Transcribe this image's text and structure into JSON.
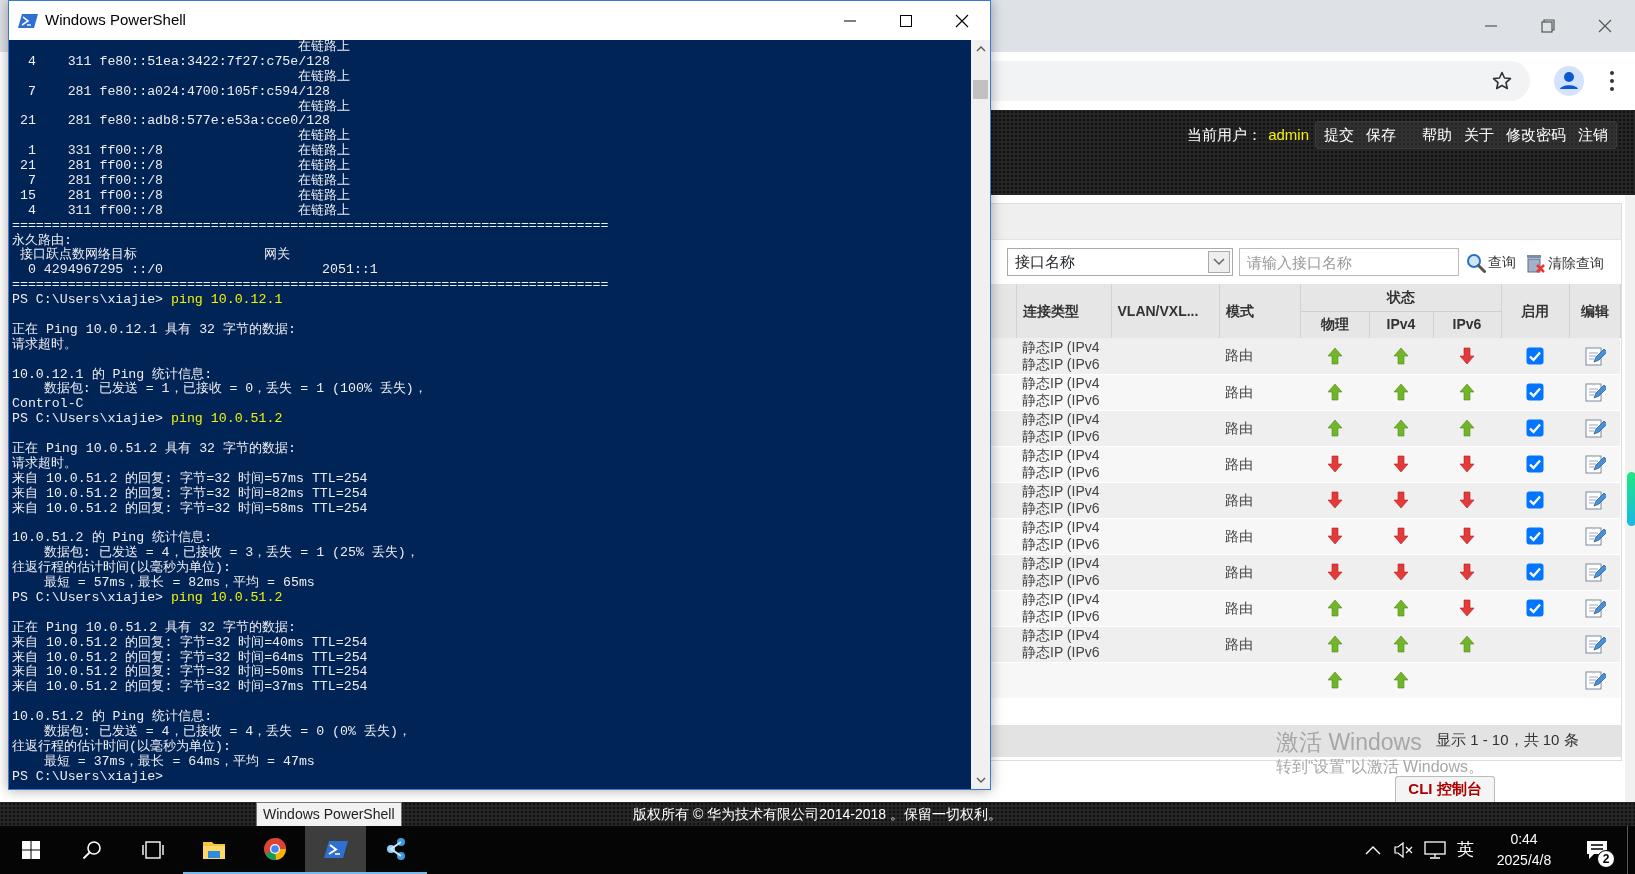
{
  "powershell": {
    "title": "Windows PowerShell",
    "lines": [
      {
        "text": "                                    在链路上"
      },
      {
        "text": "  4    311 fe80::51ea:3422:7f27:c75e/128"
      },
      {
        "text": "                                    在链路上"
      },
      {
        "text": "  7    281 fe80::a024:4700:105f:c594/128"
      },
      {
        "text": "                                    在链路上"
      },
      {
        "text": " 21    281 fe80::adb8:577e:e53a:cce0/128"
      },
      {
        "text": "                                    在链路上"
      },
      {
        "text": "  1    331 ff00::/8                 在链路上"
      },
      {
        "text": " 21    281 ff00::/8                 在链路上"
      },
      {
        "text": "  7    281 ff00::/8                 在链路上"
      },
      {
        "text": " 15    281 ff00::/8                 在链路上"
      },
      {
        "text": "  4    311 ff00::/8                 在链路上"
      },
      {
        "text": "==========================================================================="
      },
      {
        "text": "永久路由:"
      },
      {
        "text": " 接口跃点数网络目标                网关"
      },
      {
        "text": "  0 4294967295 ::/0                    2051::1"
      },
      {
        "text": "==========================================================================="
      },
      {
        "kind": "prompt",
        "prompt": "PS C:\\Users\\xiajie>",
        "command": "ping 10.0.12.1"
      },
      {
        "kind": "blank"
      },
      {
        "text": "正在 Ping 10.0.12.1 具有 32 字节的数据:"
      },
      {
        "text": "请求超时。"
      },
      {
        "kind": "blank"
      },
      {
        "text": "10.0.12.1 的 Ping 统计信息:"
      },
      {
        "text": "    数据包: 已发送 = 1，已接收 = 0，丢失 = 1 (100% 丢失)，"
      },
      {
        "text": "Control-C"
      },
      {
        "kind": "prompt",
        "prompt": "PS C:\\Users\\xiajie>",
        "command": "ping 10.0.51.2"
      },
      {
        "kind": "blank"
      },
      {
        "text": "正在 Ping 10.0.51.2 具有 32 字节的数据:"
      },
      {
        "text": "请求超时。"
      },
      {
        "text": "来自 10.0.51.2 的回复: 字节=32 时间=57ms TTL=254"
      },
      {
        "text": "来自 10.0.51.2 的回复: 字节=32 时间=82ms TTL=254"
      },
      {
        "text": "来自 10.0.51.2 的回复: 字节=32 时间=58ms TTL=254"
      },
      {
        "kind": "blank"
      },
      {
        "text": "10.0.51.2 的 Ping 统计信息:"
      },
      {
        "text": "    数据包: 已发送 = 4，已接收 = 3，丢失 = 1 (25% 丢失)，"
      },
      {
        "text": "往返行程的估计时间(以毫秒为单位):"
      },
      {
        "text": "    最短 = 57ms，最长 = 82ms，平均 = 65ms"
      },
      {
        "kind": "prompt",
        "prompt": "PS C:\\Users\\xiajie>",
        "command": "ping 10.0.51.2"
      },
      {
        "kind": "blank"
      },
      {
        "text": "正在 Ping 10.0.51.2 具有 32 字节的数据:"
      },
      {
        "text": "来自 10.0.51.2 的回复: 字节=32 时间=40ms TTL=254"
      },
      {
        "text": "来自 10.0.51.2 的回复: 字节=32 时间=64ms TTL=254"
      },
      {
        "text": "来自 10.0.51.2 的回复: 字节=32 时间=50ms TTL=254"
      },
      {
        "text": "来自 10.0.51.2 的回复: 字节=32 时间=37ms TTL=254"
      },
      {
        "kind": "blank"
      },
      {
        "text": "10.0.51.2 的 Ping 统计信息:"
      },
      {
        "text": "    数据包: 已发送 = 4，已接收 = 4，丢失 = 0 (0% 丢失)，"
      },
      {
        "text": "往返行程的估计时间(以毫秒为单位):"
      },
      {
        "text": "    最短 = 37ms，最长 = 64ms，平均 = 47ms"
      },
      {
        "kind": "prompt",
        "prompt": "PS C:\\Users\\xiajie>"
      }
    ]
  },
  "browser": {
    "header": {
      "user_label": "当前用户：",
      "user": "admin",
      "links": [
        "提交",
        "保存",
        "帮助",
        "关于",
        "修改密码",
        "注销"
      ]
    },
    "filter": {
      "select_value": "接口名称",
      "placeholder": "请输入接口名称",
      "buttons": [
        {
          "kind": "search",
          "label": "查询"
        },
        {
          "kind": "clear",
          "label": "清除查询"
        }
      ]
    },
    "table": {
      "columns": [
        "连接类型",
        "VLAN/VXL...",
        "模式"
      ],
      "status_group": "状态",
      "status_columns": [
        "物理",
        "IPv4",
        "IPv6"
      ],
      "end_columns": [
        "启用",
        "编辑"
      ],
      "rows": [
        {
          "connection": [
            "静态IP (IPv4",
            "静态IP (IPv6"
          ],
          "mode": "路由",
          "physical_up": true,
          "ipv4_up": true,
          "ipv6_up": false,
          "enabled": true
        },
        {
          "connection": [
            "静态IP (IPv4",
            "静态IP (IPv6"
          ],
          "mode": "路由",
          "physical_up": true,
          "ipv4_up": true,
          "ipv6_up": true,
          "enabled": true
        },
        {
          "connection": [
            "静态IP (IPv4",
            "静态IP (IPv6"
          ],
          "mode": "路由",
          "physical_up": true,
          "ipv4_up": true,
          "ipv6_up": true,
          "enabled": true
        },
        {
          "connection": [
            "静态IP (IPv4",
            "静态IP (IPv6"
          ],
          "mode": "路由",
          "physical_up": false,
          "ipv4_up": false,
          "ipv6_up": false,
          "enabled": true
        },
        {
          "connection": [
            "静态IP (IPv4",
            "静态IP (IPv6"
          ],
          "mode": "路由",
          "physical_up": false,
          "ipv4_up": false,
          "ipv6_up": false,
          "enabled": true
        },
        {
          "connection": [
            "静态IP (IPv4",
            "静态IP (IPv6"
          ],
          "mode": "路由",
          "physical_up": false,
          "ipv4_up": false,
          "ipv6_up": false,
          "enabled": true
        },
        {
          "connection": [
            "静态IP (IPv4",
            "静态IP (IPv6"
          ],
          "mode": "路由",
          "physical_up": false,
          "ipv4_up": false,
          "ipv6_up": false,
          "enabled": true
        },
        {
          "connection": [
            "静态IP (IPv4",
            "静态IP (IPv6"
          ],
          "mode": "路由",
          "physical_up": true,
          "ipv4_up": true,
          "ipv6_up": false,
          "enabled": true
        },
        {
          "connection": [
            "静态IP (IPv4",
            "静态IP (IPv6"
          ],
          "mode": "路由",
          "physical_up": true,
          "ipv4_up": true,
          "ipv6_up": true,
          "enabled": false
        },
        {
          "physical_up": true,
          "ipv4_up": true,
          "enabled": false
        }
      ]
    },
    "pager": "显示 1 - 10，共 10 条",
    "cli_tab": "CLI 控制台",
    "footer": "版权所有 © 华为技术有限公司2014-2018 。保留一切权利。"
  },
  "tooltip": "Windows PowerShell",
  "activation_notice": {
    "title": "激活 Windows",
    "text": "转到“设置”以激活 Windows。"
  },
  "taskbar": {
    "apps": [
      {
        "kind": "explorer",
        "running": true,
        "selected": false
      },
      {
        "kind": "browser",
        "running": true,
        "selected": false
      },
      {
        "kind": "powershell",
        "running": true,
        "selected": true
      },
      {
        "kind": "nodes",
        "running": true,
        "selected": false
      }
    ],
    "input_method": "英",
    "time": "0:44",
    "date": "2025/4/8",
    "notification_count": "2"
  }
}
